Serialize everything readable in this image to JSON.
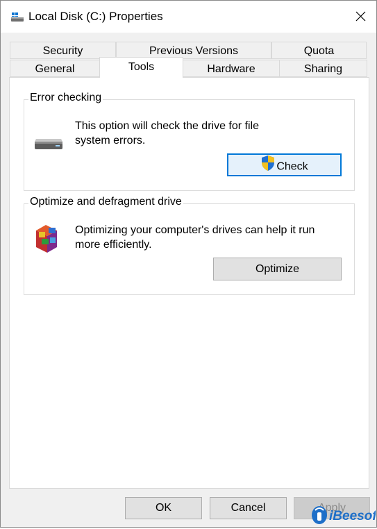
{
  "window": {
    "title": "Local Disk (C:) Properties",
    "icon": "drive-icon",
    "close_icon": "close-icon"
  },
  "tabs": {
    "row_back": [
      "Security",
      "Previous Versions",
      "Quota"
    ],
    "row_front": [
      "General",
      "Tools",
      "Hardware",
      "Sharing"
    ],
    "active": "Tools"
  },
  "error_checking": {
    "label": "Error checking",
    "description_line1": "This option will check the drive for file",
    "description_line2": "system errors.",
    "button": "Check",
    "icon": "drive-icon",
    "button_icon": "shield-icon"
  },
  "optimize": {
    "label": "Optimize and defragment drive",
    "description_line1": "Optimizing your computer's drives can help it run",
    "description_line2": "more efficiently.",
    "button": "Optimize",
    "icon": "defrag-icon"
  },
  "footer": {
    "ok": "OK",
    "cancel": "Cancel",
    "apply": "Apply"
  },
  "watermark": {
    "text": "iBeesoft"
  },
  "colors": {
    "accent": "#0078d7",
    "window_bg": "#f0f0f0",
    "panel_bg": "#ffffff"
  }
}
